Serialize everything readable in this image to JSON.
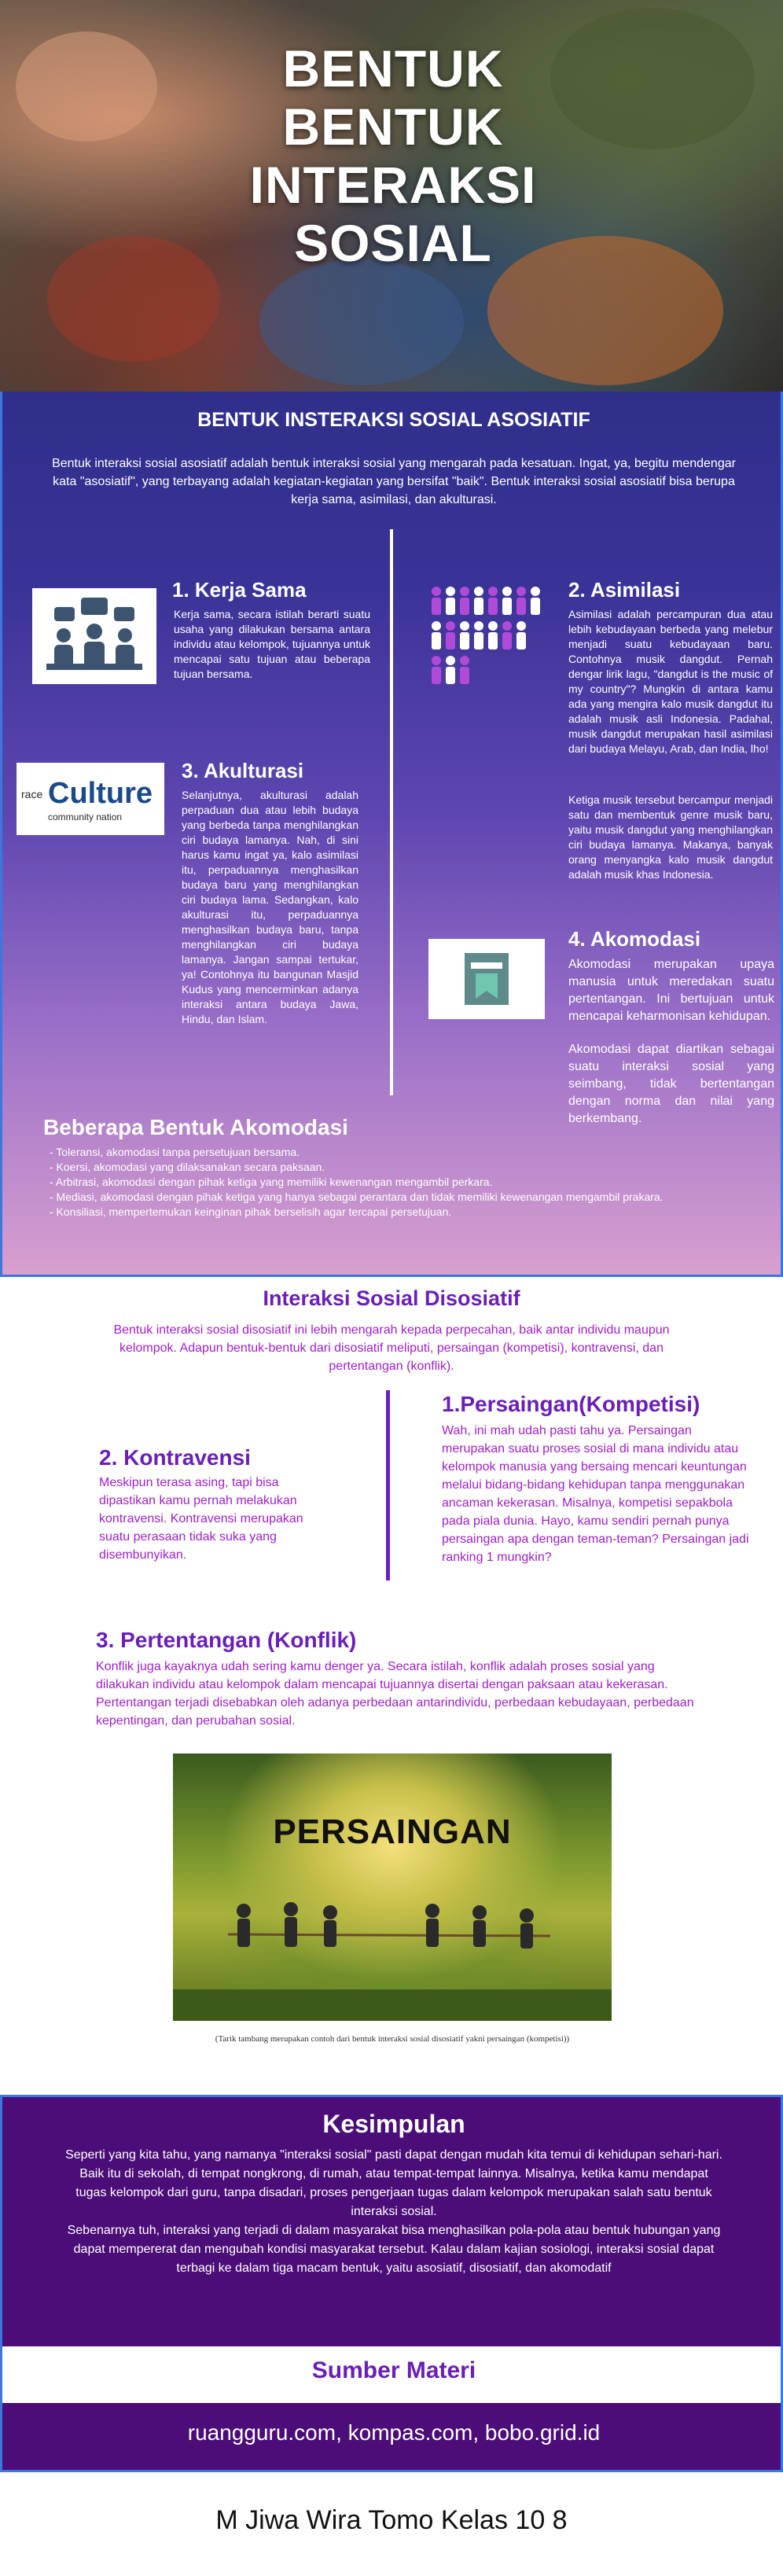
{
  "hero": {
    "title_lines": [
      "BENTUK",
      "BENTUK",
      "INTERAKSI",
      "SOSIAL"
    ]
  },
  "asosiatif": {
    "title": "BENTUK INSTERAKSI SOSIAL ASOSIATIF",
    "intro": "Bentuk interaksi sosial asosiatif adalah bentuk interaksi sosial yang mengarah pada kesatuan. Ingat, ya, begitu mendengar kata \"asosiatif\", yang terbayang adalah kegiatan-kegiatan yang bersifat \"baik\". Bentuk interaksi sosial asosiatif bisa berupa kerja sama, asimilasi, dan akulturasi.",
    "kerja_sama": {
      "title": "1. Kerja Sama",
      "text": "Kerja sama, secara istilah berarti suatu usaha yang dilakukan bersama antara individu atau kelompok, tujuannya untuk mencapai satu tujuan atau beberapa tujuan bersama."
    },
    "asimilasi": {
      "title": "2. Asimilasi",
      "text1": "Asimilasi adalah percampuran dua atau lebih kebudayaan berbeda yang melebur menjadi suatu kebudayaan baru. Contohnya musik dangdut. Pernah dengar lirik lagu, \"dangdut is the music of my country\"? Mungkin di antara kamu ada yang mengira kalo musik dangdut itu adalah musik asli Indonesia. Padahal, musik dangdut merupakan hasil asimilasi dari budaya Melayu, Arab, dan India, lho!",
      "text2": "Ketiga musik tersebut bercampur menjadi satu dan membentuk genre musik baru, yaitu musik dangdut yang menghilangkan ciri budaya lamanya. Makanya, banyak orang menyangka kalo musik dangdut adalah musik khas Indonesia."
    },
    "akulturasi": {
      "title": "3. Akulturasi",
      "badge_word": "Culture",
      "badge_small1": "race",
      "badge_small2": "community nation",
      "text": "Selanjutnya, akulturasi adalah perpaduan dua atau lebih budaya yang berbeda tanpa menghilangkan ciri budaya lamanya. Nah, di sini harus kamu ingat ya, kalo asimilasi itu, perpaduannya menghasilkan budaya baru yang menghilangkan ciri budaya lama. Sedangkan, kalo akulturasi itu, perpaduannya menghasilkan budaya baru, tanpa menghilangkan ciri budaya lamanya. Jangan sampai tertukar, ya! Contohnya itu bangunan Masjid Kudus yang mencerminkan adanya interaksi antara budaya Jawa, Hindu, dan Islam."
    },
    "akomodasi": {
      "title": "4. Akomodasi",
      "text1": "Akomodasi merupakan upaya manusia untuk meredakan suatu pertentangan. Ini bertujuan untuk mencapai keharmonisan kehidupan.",
      "text2": "Akomodasi dapat diartikan sebagai suatu interaksi sosial yang seimbang, tidak bertentangan dengan norma dan nilai yang berkembang."
    },
    "bentuk_akomodasi": {
      "title": "Beberapa Bentuk Akomodasi",
      "items": [
        "- Toleransi, akomodasi tanpa persetujuan bersama.",
        "- Koersi, akomodasi yang dilaksanakan secara paksaan.",
        "- Arbitrasi, akomodasi dengan pihak ketiga yang memiliki kewenangan mengambil perkara.",
        "- Mediasi, akomodasi dengan pihak ketiga yang hanya sebagai perantara dan tidak memiliki kewenangan mengambil prakara.",
        "- Konsiliasi, mempertemukan keinginan pihak berselisih agar tercapai persetujuan."
      ]
    }
  },
  "disosiatif": {
    "title": "Interaksi Sosial Disosiatif",
    "intro": "Bentuk interaksi sosial disosiatif ini lebih mengarah kepada perpecahan, baik antar individu maupun kelompok. Adapun bentuk-bentuk dari disosiatif meliputi, persaingan (kompetisi), kontravensi, dan pertentangan (konflik).",
    "persaingan": {
      "title": "1.Persaingan(Kompetisi)",
      "text": "Wah, ini mah udah pasti tahu ya. Persaingan merupakan suatu proses sosial di mana individu atau kelompok manusia yang bersaing mencari keuntungan melalui bidang-bidang kehidupan tanpa menggunakan ancaman kekerasan. Misalnya, kompetisi sepakbola pada piala dunia. Hayo, kamu sendiri pernah punya persaingan apa dengan teman-teman? Persaingan jadi ranking 1 mungkin?"
    },
    "kontravensi": {
      "title": "2. Kontravensi",
      "text": "Meskipun terasa asing, tapi bisa dipastikan kamu pernah melakukan kontravensi. Kontravensi merupakan suatu perasaan tidak suka yang disembunyikan."
    },
    "pertentangan": {
      "title": "3. Pertentangan (Konflik)",
      "text": "Konflik juga kayaknya udah sering kamu denger ya. Secara istilah, konflik adalah proses sosial yang dilakukan individu atau kelompok dalam mencapai tujuannya disertai dengan paksaan atau kekerasan. Pertentangan terjadi disebabkan oleh adanya perbedaan antarindividu, perbedaan kebudayaan, perbedaan kepentingan, dan perubahan sosial."
    },
    "photo_label": "PERSAINGAN",
    "caption": "(Tarik tambang merupakan contoh dari bentuk interaksi sosial disosiatif yakni persaingan (kompetisi))"
  },
  "kesimpulan": {
    "title": "Kesimpulan",
    "p1": "Seperti yang kita tahu, yang namanya \"interaksi sosial\" pasti dapat dengan mudah kita temui di kehidupan sehari-hari. Baik itu di sekolah, di tempat nongkrong, di rumah, atau tempat-tempat lainnya. Misalnya, ketika kamu mendapat tugas kelompok dari guru, tanpa disadari, proses pengerjaan tugas dalam kelompok merupakan salah satu bentuk interaksi sosial.",
    "p2": "Sebenarnya tuh, interaksi yang terjadi di dalam masyarakat bisa menghasilkan pola-pola atau bentuk hubungan yang dapat mempererat dan mengubah kondisi masyarakat tersebut. Kalau dalam kajian sosiologi, interaksi sosial dapat terbagi ke dalam tiga macam bentuk, yaitu asosiatif, disosiatif, dan akomodatif"
  },
  "sumber": {
    "title": "Sumber Materi",
    "sources": "ruangguru.com, kompas.com, bobo.grid.id"
  },
  "author": "M Jiwa Wira Tomo Kelas 10 8"
}
